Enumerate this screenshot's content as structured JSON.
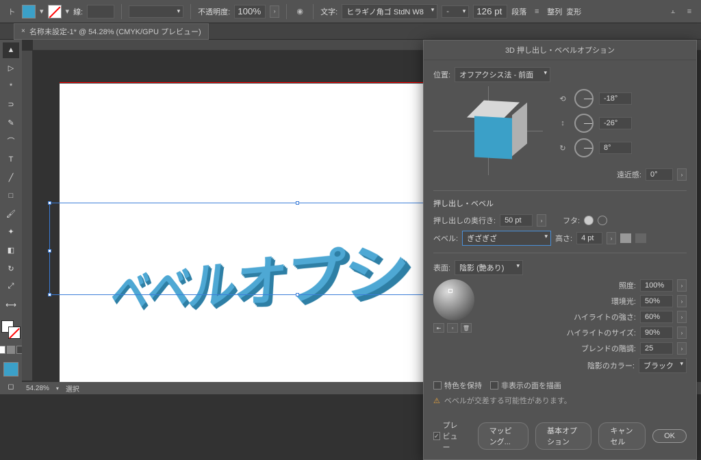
{
  "toolbar": {
    "stroke_label": "線:",
    "stroke_weight": "",
    "opacity_label": "不透明度:",
    "opacity_value": "100%",
    "type_label": "文字:",
    "font_family": "ヒラギノ角ゴ StdN W8",
    "font_style": "-",
    "font_size": "126 pt",
    "paragraph_label": "段落",
    "align_label": "整列",
    "transform_label": "変形"
  },
  "tab": {
    "title": "名称未設定-1* @ 54.28% (CMYK/GPU プレビュー)"
  },
  "canvas": {
    "text3d": "ベベルオプショ"
  },
  "status": {
    "zoom": "54.28%",
    "mode": "選択"
  },
  "dialog": {
    "title": "3D 押し出し・ベベルオプション",
    "position_label": "位置:",
    "position_value": "オフアクシス法 - 前面",
    "angle_x": "-18°",
    "angle_y": "-26°",
    "angle_z": "8°",
    "perspective_label": "遠近感:",
    "perspective_value": "0°",
    "extrude_section": "押し出し・ベベル",
    "depth_label": "押し出しの奥行き:",
    "depth_value": "50 pt",
    "cap_label": "フタ:",
    "bevel_label": "ベベル:",
    "bevel_value": "ぎざぎざ",
    "height_label": "高さ:",
    "height_value": "4 pt",
    "surface_label": "表面:",
    "surface_value": "陰影 (艶あり)",
    "intensity_label": "照度:",
    "intensity_value": "100%",
    "ambient_label": "環境光:",
    "ambient_value": "50%",
    "highlight_intensity_label": "ハイライトの強さ:",
    "highlight_intensity_value": "60%",
    "highlight_size_label": "ハイライトのサイズ:",
    "highlight_size_value": "90%",
    "blend_steps_label": "ブレンドの階調:",
    "blend_steps_value": "25",
    "shade_color_label": "陰影のカラー:",
    "shade_color_value": "ブラック",
    "preserve_spot_label": "特色を保持",
    "draw_hidden_label": "非表示の面を描画",
    "warning_text": "ベベルが交差する可能性があります。",
    "preview_label": "プレビュー",
    "mapping_btn": "マッピング...",
    "basic_btn": "基本オプション",
    "cancel_btn": "キャンセル",
    "ok_btn": "OK"
  }
}
